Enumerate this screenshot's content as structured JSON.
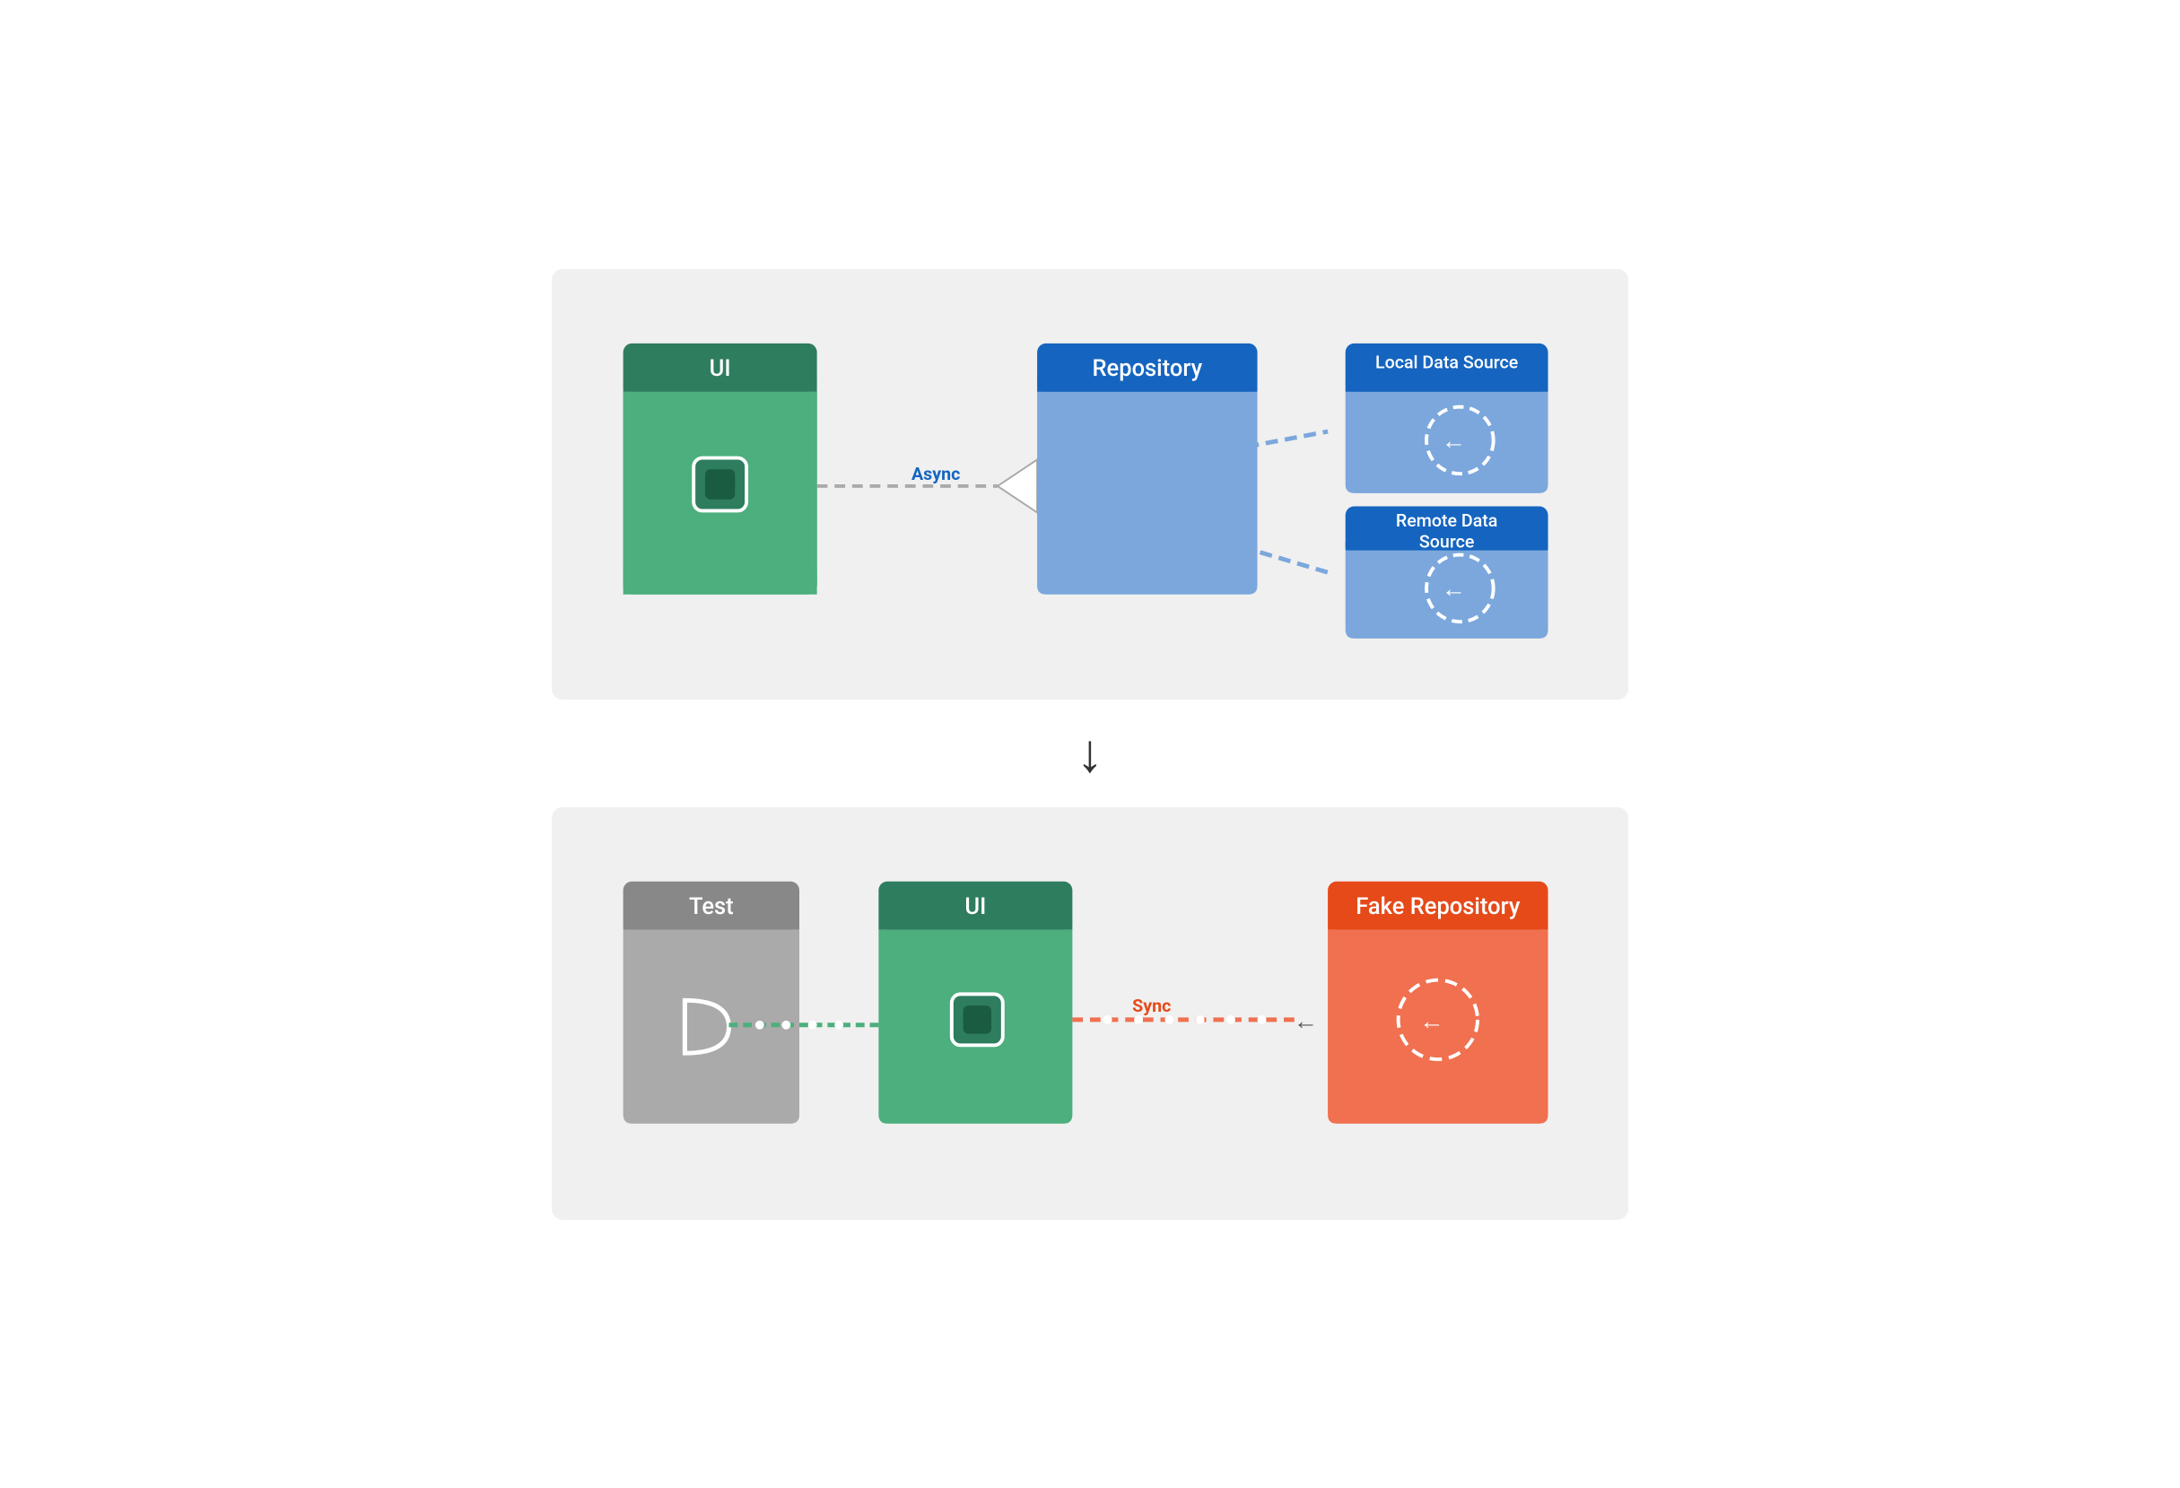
{
  "top_diagram": {
    "ui_label": "UI",
    "repo_label": "Repository",
    "async_label": "Async",
    "local_ds_label": "Local Data Source",
    "remote_ds_label": "Remote Data Source",
    "source_label": "Source"
  },
  "bottom_diagram": {
    "test_label": "Test",
    "ui_label": "UI",
    "fake_repo_label": "Fake Repository",
    "sync_label": "Sync"
  },
  "colors": {
    "dark_green": "#2e7d5e",
    "green": "#4caf7d",
    "dark_blue": "#1565c0",
    "mid_blue": "#7ba7dc",
    "light_blue": "#5c8dd6",
    "orange_dark": "#e64a19",
    "orange_light": "#f07050",
    "gray_dark": "#888888",
    "gray_light": "#aaaaaa",
    "bg": "#f0f0f0"
  }
}
